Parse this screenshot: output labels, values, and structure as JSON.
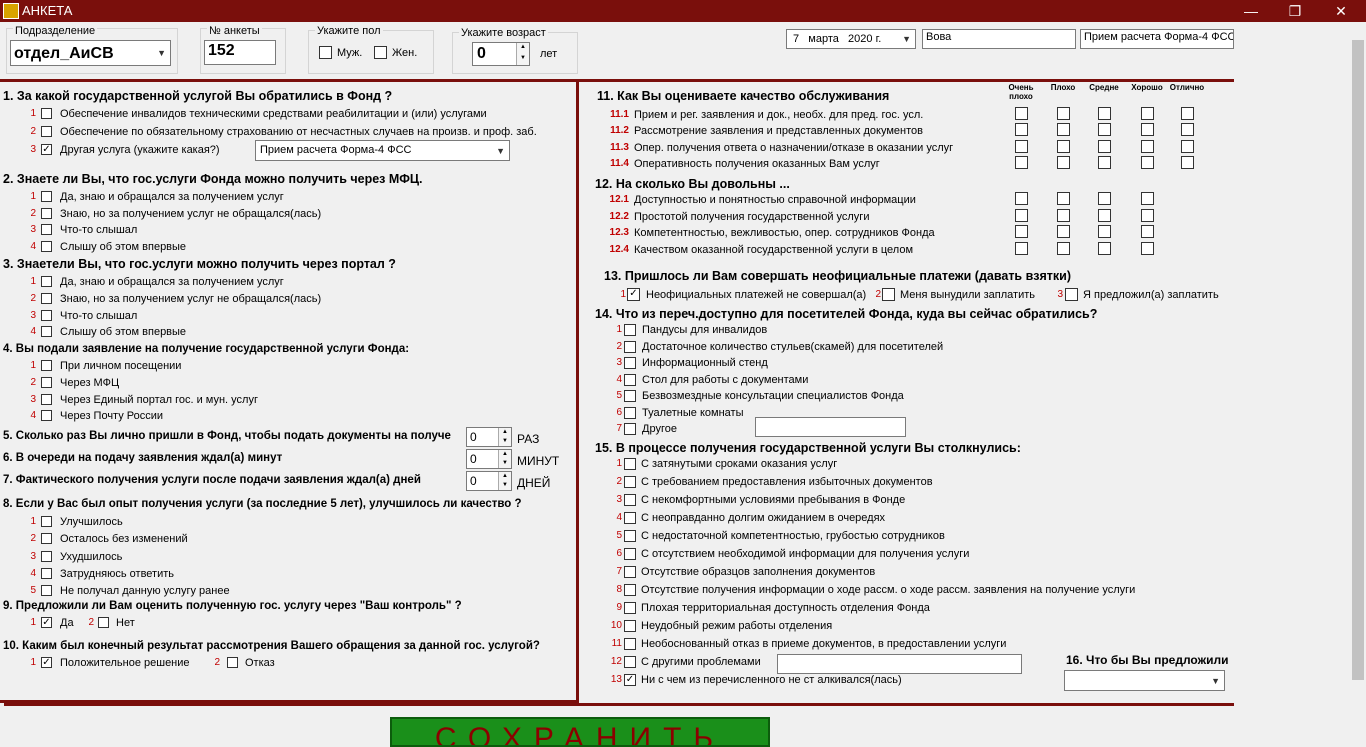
{
  "window": {
    "title": "АНКЕТА",
    "min": "—",
    "max": "❐",
    "close": "✕"
  },
  "header": {
    "dept_label": "Подразделение",
    "dept_value": "отдел_АиСВ",
    "num_label": "№ анкеты",
    "num_value": "152",
    "sex_label": "Укажите пол",
    "male": "Муж.",
    "female": "Жен.",
    "age_label": "Укажите возраст",
    "age_value": "0",
    "age_unit": "лет",
    "date_value": "7   марта   2020 г.",
    "user_value": "Вова",
    "service_value": "Прием расчета Форма-4 ФСС"
  },
  "q1": {
    "title": "1. За какой государственной услугой Вы обратились в Фонд ?",
    "options": [
      {
        "n": "1",
        "text": "Обеспечение инвалидов техническими средствами реабилитации и (или) услугами",
        "checked": false
      },
      {
        "n": "2",
        "text": "Обеспечение  по обязательному страхованию от несчастных случаев на произв. и проф. заб.",
        "checked": false
      },
      {
        "n": "3",
        "text": "Другая услуга (укажите какая?)",
        "checked": true
      }
    ],
    "other_value": "Прием расчета Форма-4 ФСС"
  },
  "q2": {
    "title": "2. Знаете ли Вы, что гос.услуги Фонда можно получить через МФЦ.",
    "options": [
      {
        "n": "1",
        "text": "Да, знаю и обращался за получением услуг"
      },
      {
        "n": "2",
        "text": "Знаю, но за получением услуг не обращался(лась)"
      },
      {
        "n": "3",
        "text": "Что-то слышал"
      },
      {
        "n": "4",
        "text": "Слышу об этом впервые"
      }
    ]
  },
  "q3": {
    "title": "3. Знаетели Вы, что гос.услуги можно получить через портал ?",
    "options": [
      {
        "n": "1",
        "text": "Да, знаю и обращался за получением услуг"
      },
      {
        "n": "2",
        "text": "Знаю, но за получением услуг не обращался(лась)"
      },
      {
        "n": "3",
        "text": "Что-то слышал"
      },
      {
        "n": "4",
        "text": "Слышу об этом впервые"
      }
    ]
  },
  "q4": {
    "title": "4. Вы подали заявление на получение государственной услуги Фонда:",
    "options": [
      {
        "n": "1",
        "text": "При личном посещении"
      },
      {
        "n": "2",
        "text": "Через МФЦ"
      },
      {
        "n": "3",
        "text": "Через Единый портал гос. и мун. услуг"
      },
      {
        "n": "4",
        "text": "Через Почту России"
      }
    ]
  },
  "q5": {
    "title": "5. Сколько раз Вы лично пришли в Фонд, чтобы подать документы на получе",
    "value": "0",
    "unit": "РАЗ"
  },
  "q6": {
    "title": "6. В очереди на подачу заявления ждал(а) минут",
    "value": "0",
    "unit": "МИНУТ"
  },
  "q7": {
    "title": "7.  Фактического получения услуги после подачи заявления ждал(а) дней",
    "value": "0",
    "unit": "ДНЕЙ"
  },
  "q8": {
    "title": "8. Если у Вас был опыт получения услуги (за последние 5 лет), улучшилось ли качество ?",
    "options": [
      {
        "n": "1",
        "text": "Улучшилось"
      },
      {
        "n": "2",
        "text": "Осталось без изменений"
      },
      {
        "n": "3",
        "text": "Ухудшилось"
      },
      {
        "n": "4",
        "text": "Затрудняюсь ответить"
      },
      {
        "n": "5",
        "text": "Не получал данную услугу ранее"
      }
    ]
  },
  "q9": {
    "title": "9. Предложили ли Вам оценить полученную гос. услугу через  \"Ваш контроль\" ?",
    "yes": "Да",
    "no": "Нет",
    "n1": "1",
    "n2": "2"
  },
  "q10": {
    "title": "10. Каким был конечный результат рассмотрения Вашего обращения за данной гос. услугой?",
    "yes": "Положительное решение",
    "no": "Отказ",
    "n1": "1",
    "n2": "2"
  },
  "q11": {
    "title": "11. Как Вы оцениваете качество обслуживания",
    "cols": [
      "Очень плохо",
      "Плохо",
      "Средне",
      "Хорошо",
      "Отлично"
    ],
    "rows": [
      {
        "n": "11.1",
        "text": "Прием и рег. заявления и док., необх. для пред. гос. усл."
      },
      {
        "n": "11.2",
        "text": "Рассмотрение заявления и представленных документов"
      },
      {
        "n": "11.3",
        "text": "Опер. получения ответа о назначении/отказе  в оказании услуг"
      },
      {
        "n": "11.4",
        "text": "Оперативность получения оказанных Вам услуг"
      }
    ]
  },
  "q12": {
    "title": "12. На сколько Вы довольны ...",
    "rows": [
      {
        "n": "12.1",
        "text": "Доступностью и понятностью справочной информации"
      },
      {
        "n": "12.2",
        "text": "Простотой получения государственной услуги"
      },
      {
        "n": "12.3",
        "text": "Компетентностью, вежливостью, опер. сотрудников Фонда"
      },
      {
        "n": "12.4",
        "text": "Качеством оказанной государственной услуги в целом"
      }
    ]
  },
  "q13": {
    "title": "13. Пришлось ли Вам совершать неофициальные платежи (давать взятки)",
    "options": [
      {
        "n": "1",
        "text": "Неофициальных платежей не совершал(а)"
      },
      {
        "n": "2",
        "text": "Меня вынудили заплатить"
      },
      {
        "n": "3",
        "text": "Я предложил(а) заплатить"
      }
    ]
  },
  "q14": {
    "title": "14. Что из переч.доступно для посетителей Фонда, куда вы сейчас обратились?",
    "options": [
      {
        "n": "1",
        "text": "Пандусы для инвалидов"
      },
      {
        "n": "2",
        "text": "Достаточное количество стульев(скамей) для посетителей"
      },
      {
        "n": "3",
        "text": "Информационный стенд"
      },
      {
        "n": "4",
        "text": "Стол для работы с документами"
      },
      {
        "n": "5",
        "text": "Безвозмездные консультации специалистов Фонда"
      },
      {
        "n": "6",
        "text": "Туалетные комнаты"
      },
      {
        "n": "7",
        "text": "Другое"
      }
    ]
  },
  "q15": {
    "title": "15. В процессе получения государственной услуги Вы столкнулись:",
    "options": [
      {
        "n": "1",
        "text": "С затянутыми сроками оказания услуг"
      },
      {
        "n": "2",
        "text": "С требованием предоставления избыточных документов"
      },
      {
        "n": "3",
        "text": "С некомфортными  условиями пребывания в Фонде"
      },
      {
        "n": "4",
        "text": "С неоправданно долгим ожиданием в очередях"
      },
      {
        "n": "5",
        "text": "С недостаточной компетентностью,  грубостью сотрудников"
      },
      {
        "n": "6",
        "text": "С отсутствием необходимой информации для получения услуги"
      },
      {
        "n": "7",
        "text": "Отсутствие образцов заполнения документов"
      },
      {
        "n": "8",
        "text": "Отсутствие получения информации о ходе рассм. о ходе рассм. заявления на получение услуги"
      },
      {
        "n": "9",
        "text": "Плохая территориальная доступность отделения Фонда"
      },
      {
        "n": "10",
        "text": "Неудобный режим работы отделения"
      },
      {
        "n": "11",
        "text": "Необоснованный отказ  в приеме документов,  в предоставлении услуги"
      },
      {
        "n": "12",
        "text": "С другими проблемами"
      },
      {
        "n": "13",
        "text": "Ни с чем из перечисленного не ст алкивался(лась)"
      }
    ]
  },
  "q16": {
    "title": "16. Что бы Вы предложили"
  },
  "save_label": "СОХРАНИТЬ"
}
